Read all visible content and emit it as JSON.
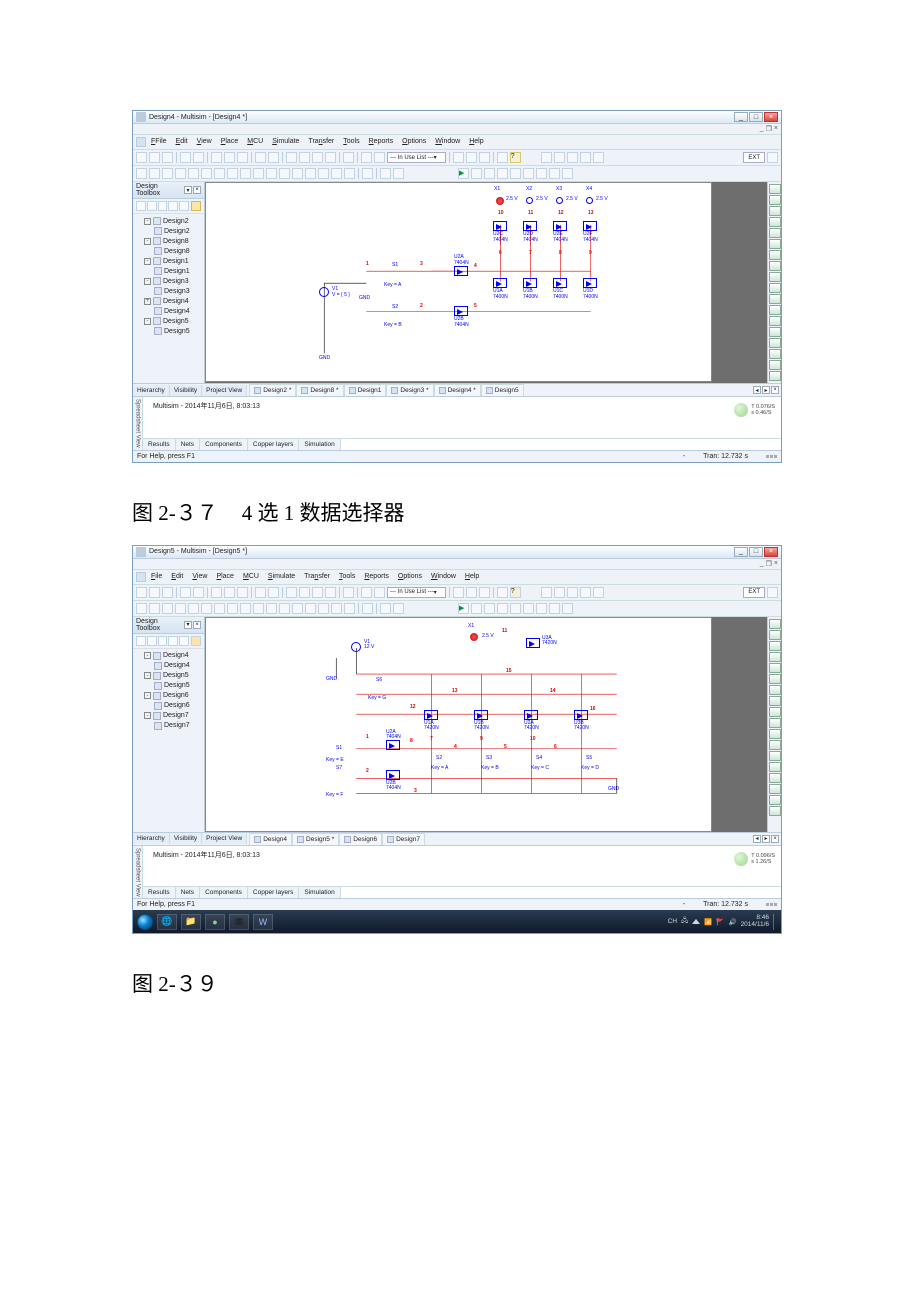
{
  "caption1": {
    "prefix": "图 2-３７",
    "title": "4 选 1 数据选择器"
  },
  "caption2": {
    "prefix": "图 2-３９"
  },
  "app1": {
    "title": "Design4 - Multisim - [Design4 *]",
    "menus": [
      "File",
      "Edit",
      "View",
      "Place",
      "MCU",
      "Simulate",
      "Transfer",
      "Tools",
      "Reports",
      "Options",
      "Window",
      "Help"
    ],
    "combo": "--- In Use List ---",
    "toolboxTitle": "Design Toolbox",
    "tree": [
      {
        "lvl": 1,
        "exp": "-",
        "label": "Design2"
      },
      {
        "lvl": 2,
        "label": "Design2"
      },
      {
        "lvl": 1,
        "exp": "-",
        "label": "Design8"
      },
      {
        "lvl": 2,
        "label": "Design8"
      },
      {
        "lvl": 1,
        "exp": "-",
        "label": "Design1"
      },
      {
        "lvl": 2,
        "label": "Design1"
      },
      {
        "lvl": 1,
        "exp": "-",
        "label": "Design3"
      },
      {
        "lvl": 2,
        "label": "Design3"
      },
      {
        "lvl": 1,
        "exp": "+",
        "label": "Design4"
      },
      {
        "lvl": 2,
        "label": "Design4"
      },
      {
        "lvl": 1,
        "exp": "-",
        "label": "Design5"
      },
      {
        "lvl": 2,
        "label": "Design5"
      }
    ],
    "leftTabs": [
      "Hierarchy",
      "Visibility",
      "Project View"
    ],
    "docTabs": [
      "Design2 *",
      "Design8 *",
      "Design1",
      "Design3 *",
      "Design4 *",
      "Design5"
    ],
    "consoleMsg": "Multisim  -  2014年11月6日, 8:03:13",
    "consoleTabs": [
      "Results",
      "Nets",
      "Components",
      "Copper layers",
      "Simulation"
    ],
    "sim": {
      "l1": "T 0.076/S",
      "l2": "s   0.46/S"
    },
    "status": {
      "left": "For Help, press F1",
      "center": "-",
      "tran": "Tran: 12.732 s"
    },
    "schematic": {
      "X": [
        "X1",
        "X2",
        "X3",
        "X4"
      ],
      "volts": "2.5 V",
      "pins_top": [
        "10",
        "11",
        "12",
        "13"
      ],
      "u_top": [
        {
          "ref": "U2C",
          "pn": "7404N"
        },
        {
          "ref": "U2D",
          "pn": "7404N"
        },
        {
          "ref": "U2E",
          "pn": "7404N"
        },
        {
          "ref": "U2F",
          "pn": "7404N"
        }
      ],
      "S1": {
        "ref": "S1",
        "key": "Key = A",
        "net_in": "1",
        "net_out": "3",
        "pins": [
          "1",
          "2"
        ]
      },
      "S2": {
        "ref": "S2",
        "key": "Key = B",
        "net_out": "2",
        "pins": [
          "1",
          "2"
        ]
      },
      "U2A": {
        "ref": "U2A",
        "pn": "7404N",
        "out": "4"
      },
      "U2B": {
        "ref": "U2B",
        "pn": "7404N",
        "out": "5"
      },
      "V1": {
        "ref": "V1",
        "val": "V = { 5 }"
      },
      "gnd": "GND",
      "u_mid": [
        {
          "ref": "U1A",
          "pn": "7400N"
        },
        {
          "ref": "U1B",
          "pn": "7400N"
        },
        {
          "ref": "U1C",
          "pn": "7400N"
        },
        {
          "ref": "U1D",
          "pn": "7400N"
        }
      ],
      "nets_tap": [
        "6",
        "7",
        "8",
        "9"
      ]
    }
  },
  "app2": {
    "title": "Design5 - Multisim - [Design5 *]",
    "menus": [
      "File",
      "Edit",
      "View",
      "Place",
      "MCU",
      "Simulate",
      "Transfer",
      "Tools",
      "Reports",
      "Options",
      "Window",
      "Help"
    ],
    "combo": "--- In Use List ---",
    "toolboxTitle": "Design Toolbox",
    "tree": [
      {
        "lvl": 1,
        "exp": "-",
        "label": "Design4"
      },
      {
        "lvl": 2,
        "label": "Design4"
      },
      {
        "lvl": 1,
        "exp": "-",
        "label": "Design5"
      },
      {
        "lvl": 2,
        "label": "Design5"
      },
      {
        "lvl": 1,
        "exp": "-",
        "label": "Design6"
      },
      {
        "lvl": 2,
        "label": "Design6"
      },
      {
        "lvl": 1,
        "exp": "-",
        "label": "Design7"
      },
      {
        "lvl": 2,
        "label": "Design7"
      }
    ],
    "leftTabs": [
      "Hierarchy",
      "Visibility",
      "Project View"
    ],
    "docTabs": [
      "Design4",
      "Design5 *",
      "Design6",
      "Design7"
    ],
    "consoleMsg": "Multisim  -  2014年11月6日, 8:03:13",
    "consoleTabs": [
      "Results",
      "Nets",
      "Components",
      "Copper layers",
      "Simulation"
    ],
    "sim": {
      "l1": "T 0.096/S",
      "l2": "s   1.26/S"
    },
    "status": {
      "left": "For Help, press F1",
      "center": "-",
      "tran": "Tran: 12.732 s"
    },
    "schematic": {
      "X1": "X1",
      "volts": "2.5 V",
      "V1": {
        "ref": "V1",
        "val": "12 V"
      },
      "gnd": "GND",
      "S6": {
        "ref": "S6",
        "key": "Key = G"
      },
      "U2A": {
        "ref": "U2A",
        "pn": "7404N"
      },
      "U2B": {
        "ref": "U2B",
        "pn": "7404N"
      },
      "U3A": {
        "ref": "U3A",
        "pn": "7420N"
      },
      "U1": [
        {
          "ref": "U1A",
          "pn": "7420N"
        },
        {
          "ref": "U1B",
          "pn": "7420N"
        },
        {
          "ref": "U2A",
          "pn": "7420N"
        },
        {
          "ref": "U3B",
          "pn": "7420N"
        }
      ],
      "S": [
        {
          "ref": "S1",
          "key": "Key = E"
        },
        {
          "ref": "S2",
          "key": "Key = A"
        },
        {
          "ref": "S3",
          "key": "Key = B"
        },
        {
          "ref": "S4",
          "key": "Key = C"
        },
        {
          "ref": "S5",
          "key": "Key = D"
        }
      ],
      "S7": {
        "ref": "S7",
        "key": "Key = F"
      },
      "nets": [
        "1",
        "2",
        "3",
        "4",
        "5",
        "6",
        "7",
        "8",
        "9",
        "10",
        "11",
        "12",
        "13",
        "14",
        "15",
        "16"
      ],
      "gnd2": "GND"
    }
  },
  "taskbar": {
    "items": [
      "🌐",
      "📁",
      "IE",
      "📘",
      "W"
    ],
    "clock": {
      "time": "8:46",
      "date": "2014/11/6"
    },
    "ime": "CH"
  }
}
